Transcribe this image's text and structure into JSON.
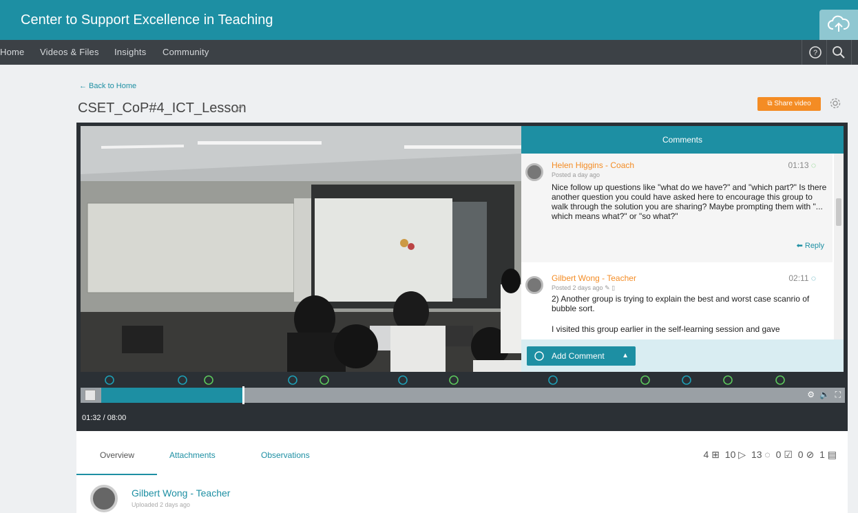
{
  "brand": {
    "title": "Center to Support Excellence in Teaching"
  },
  "nav": {
    "items": [
      "Home",
      "Videos & Files",
      "Insights",
      "Community"
    ]
  },
  "page": {
    "back_link": "← Back to Home",
    "title": "CSET_CoP#4_ICT_Lesson",
    "share_label": "Share video"
  },
  "comments": {
    "header": "Comments",
    "items": [
      {
        "author": "Helen Higgins - Coach",
        "posted": "Posted a day ago",
        "time": "01:13",
        "text": "Nice follow up questions like \"what do we have?\" and \"which part?\" Is there another question you could have asked here to encourage this group to walk through the solution you are sharing? Maybe prompting them with \"... which means what?\" or \"so what?\"",
        "reply": "Reply"
      },
      {
        "author": "Gilbert Wong - Teacher",
        "posted": "Posted 2 days ago",
        "time": "02:11",
        "text": "2) Another group is trying to explain the best and worst case scanrio of bubble sort.",
        "text2": "I visited this group earlier in the self-learning session and gave"
      }
    ],
    "add_label": "Add Comment"
  },
  "player": {
    "time": "01:32 / 08:00",
    "progress": 0.19
  },
  "tabs": {
    "items": [
      "Overview",
      "Attachments",
      "Observations"
    ],
    "active": "Overview"
  },
  "stats": [
    "4",
    "10",
    "13",
    "0",
    "0",
    "1"
  ],
  "author": {
    "name": "Gilbert Wong - Teacher",
    "sub": "Uploaded 2 days ago"
  },
  "colors": {
    "accent": "#1d8fa3",
    "orange": "#f48c24",
    "nav": "#3c4146"
  }
}
